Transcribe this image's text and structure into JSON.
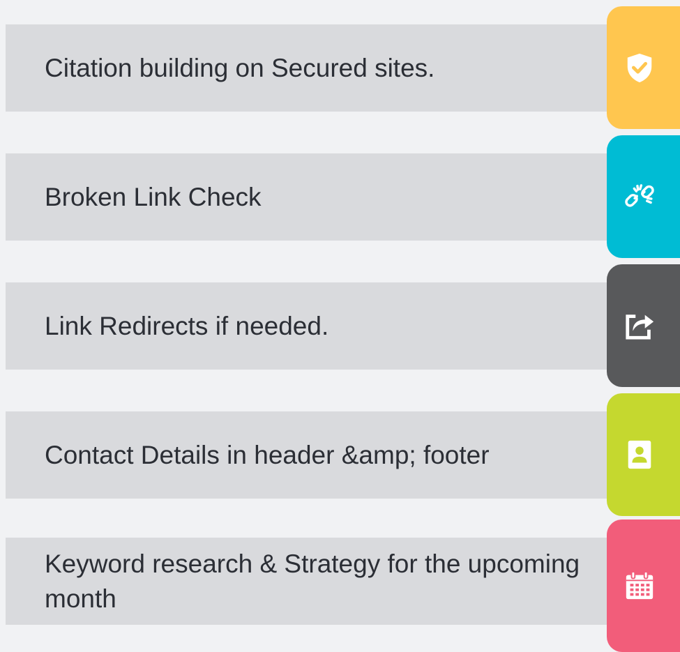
{
  "features": [
    {
      "label": "Citation building on Secured sites.",
      "icon": "shield-check-icon",
      "color": "#ffc64f"
    },
    {
      "label": "Broken Link Check",
      "icon": "broken-link-icon",
      "color": "#00bcd4"
    },
    {
      "label": "Link Redirects if needed.",
      "icon": "share-redirect-icon",
      "color": "#58595b"
    },
    {
      "label": "Contact Details in header &amp; footer",
      "icon": "contact-book-icon",
      "color": "#c5d82f"
    },
    {
      "label": "Keyword research & Strategy for the upcoming month",
      "icon": "calendar-icon",
      "color": "#f25d7a"
    }
  ]
}
